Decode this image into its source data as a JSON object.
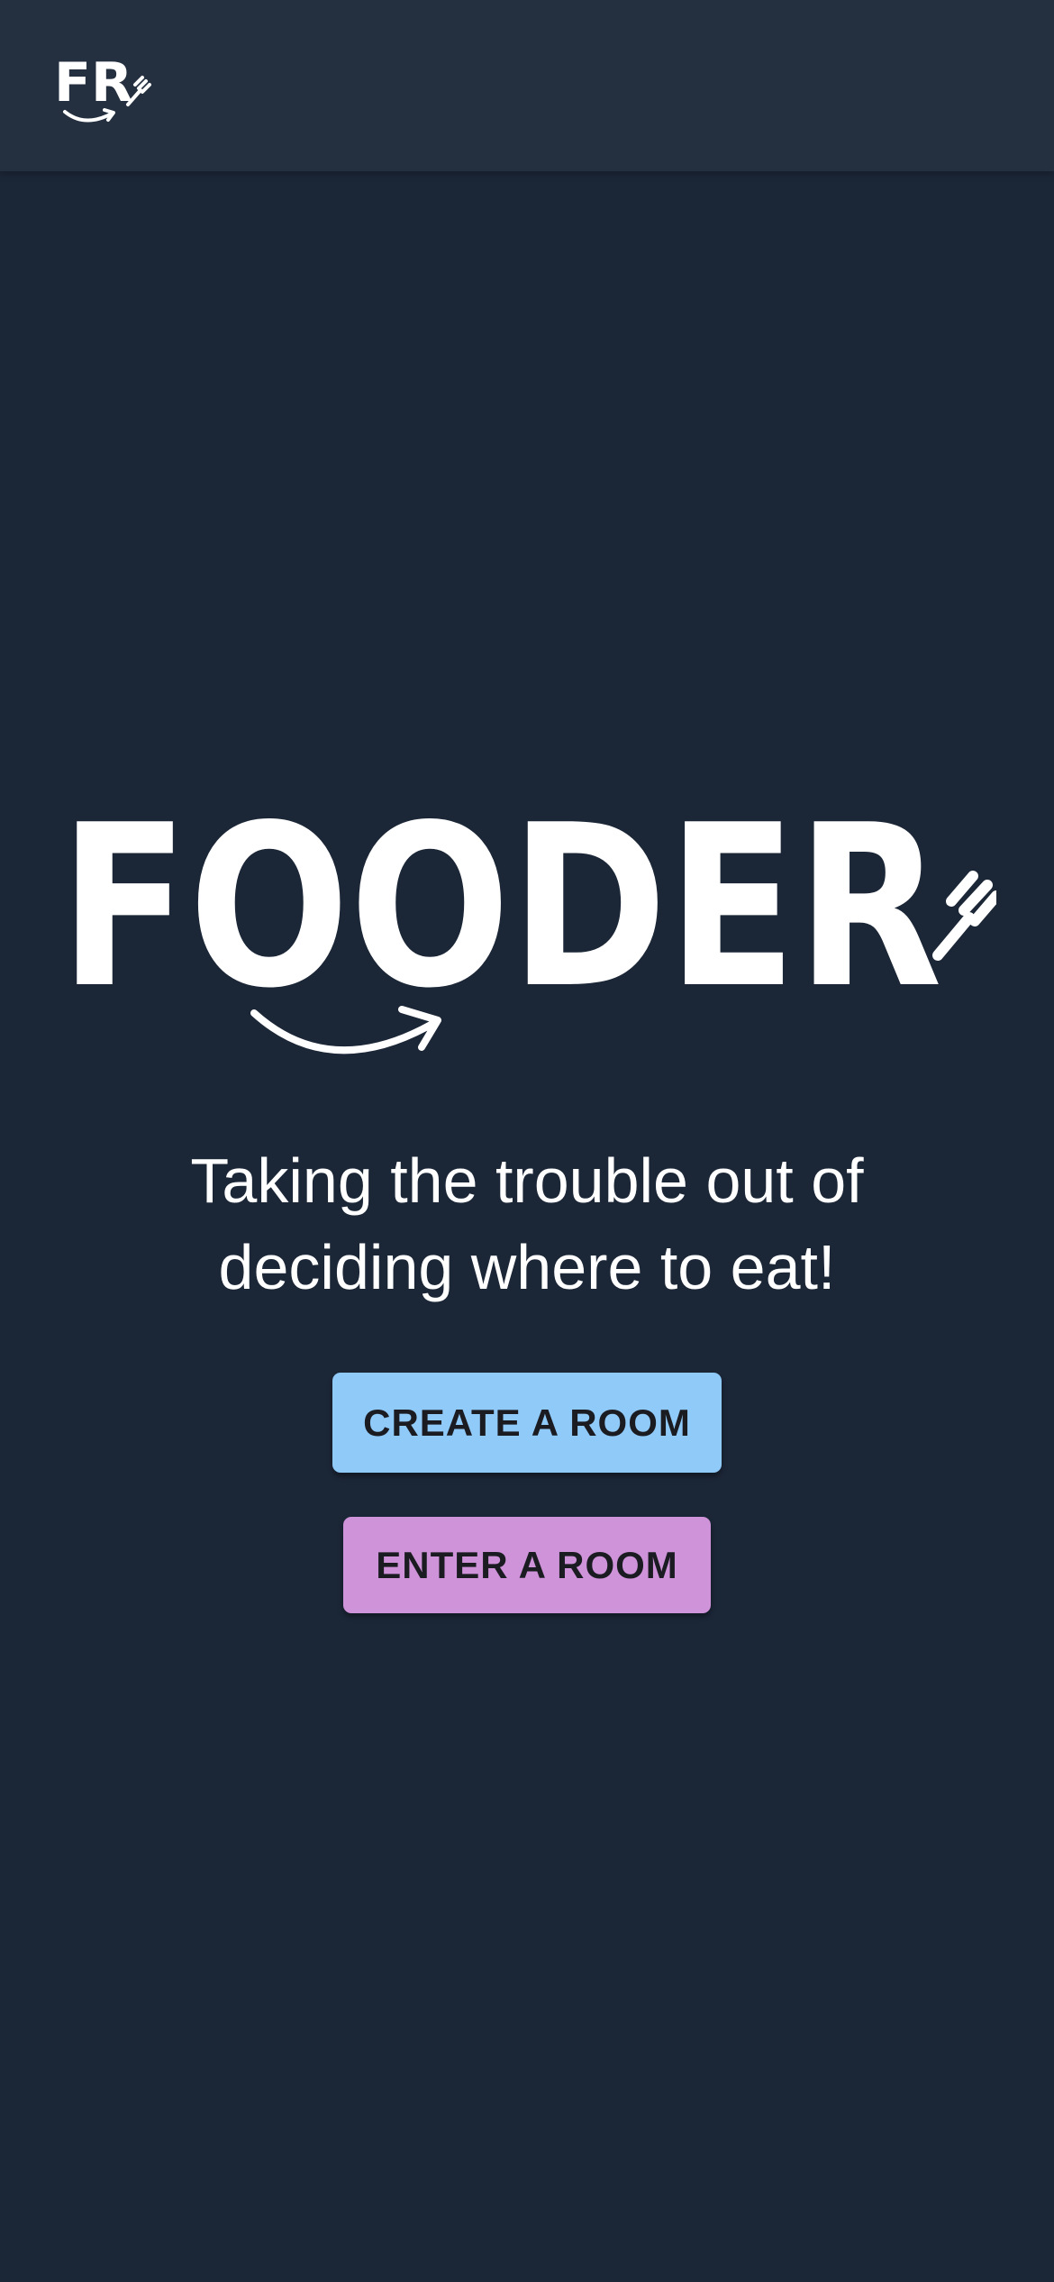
{
  "header": {
    "logo_text": "FR",
    "logo_icon": "fork-smile-logo"
  },
  "hero": {
    "logo_text": "FOODER",
    "logo_icon": "fork-smile-logo"
  },
  "tagline": {
    "line1": "Taking the trouble out of",
    "line2": "deciding where to eat!"
  },
  "actions": {
    "create_label": "CREATE A ROOM",
    "enter_label": "ENTER A ROOM"
  },
  "colors": {
    "background": "#1b2637",
    "app_bar": "#242f40",
    "create_button": "#90caf9",
    "enter_button": "#ce93d8",
    "text": "#ffffff"
  }
}
